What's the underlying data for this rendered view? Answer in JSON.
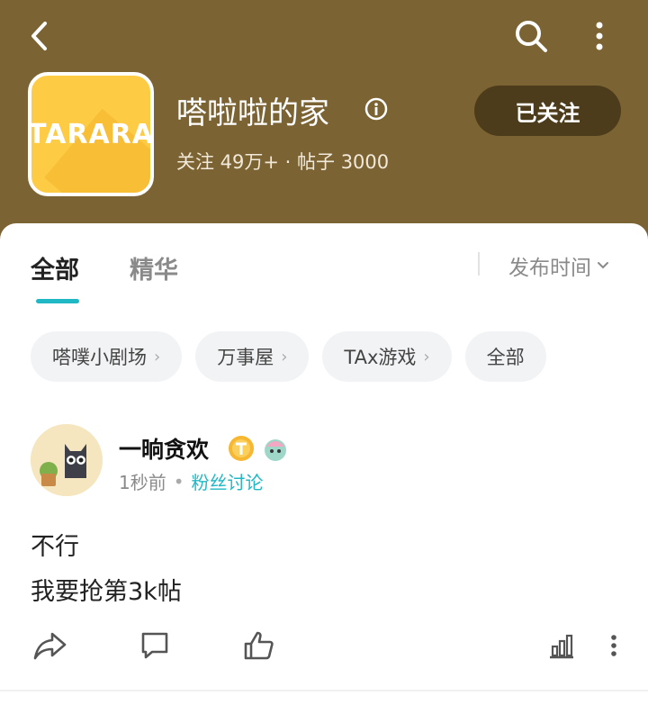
{
  "header": {
    "club_name": "嗒啦啦的家",
    "stats": "关注 49万+ · 帖子 3000",
    "follow_label": "已关注",
    "logo_text": "TARARA",
    "icons": {
      "back": "back-arrow-icon",
      "search": "search-icon",
      "more": "more-vertical-icon",
      "info": "info-icon"
    }
  },
  "tabs": [
    {
      "label": "全部",
      "active": true
    },
    {
      "label": "精华",
      "active": false
    }
  ],
  "sort": {
    "label": "发布时间"
  },
  "chips": [
    {
      "label": "嗒噗小剧场"
    },
    {
      "label": "万事屋"
    },
    {
      "label": "TAx游戏"
    },
    {
      "label": "全部"
    }
  ],
  "post": {
    "username": "一晌贪欢",
    "time": "1秒前",
    "category": "粉丝讨论",
    "lines": [
      "不行",
      "我要抢第3k帖"
    ]
  },
  "colors": {
    "header_bg": "#7c6333",
    "follow_bg": "#4d3c1b",
    "accent": "#20b8c4",
    "logo_bg": "#fecb45"
  }
}
